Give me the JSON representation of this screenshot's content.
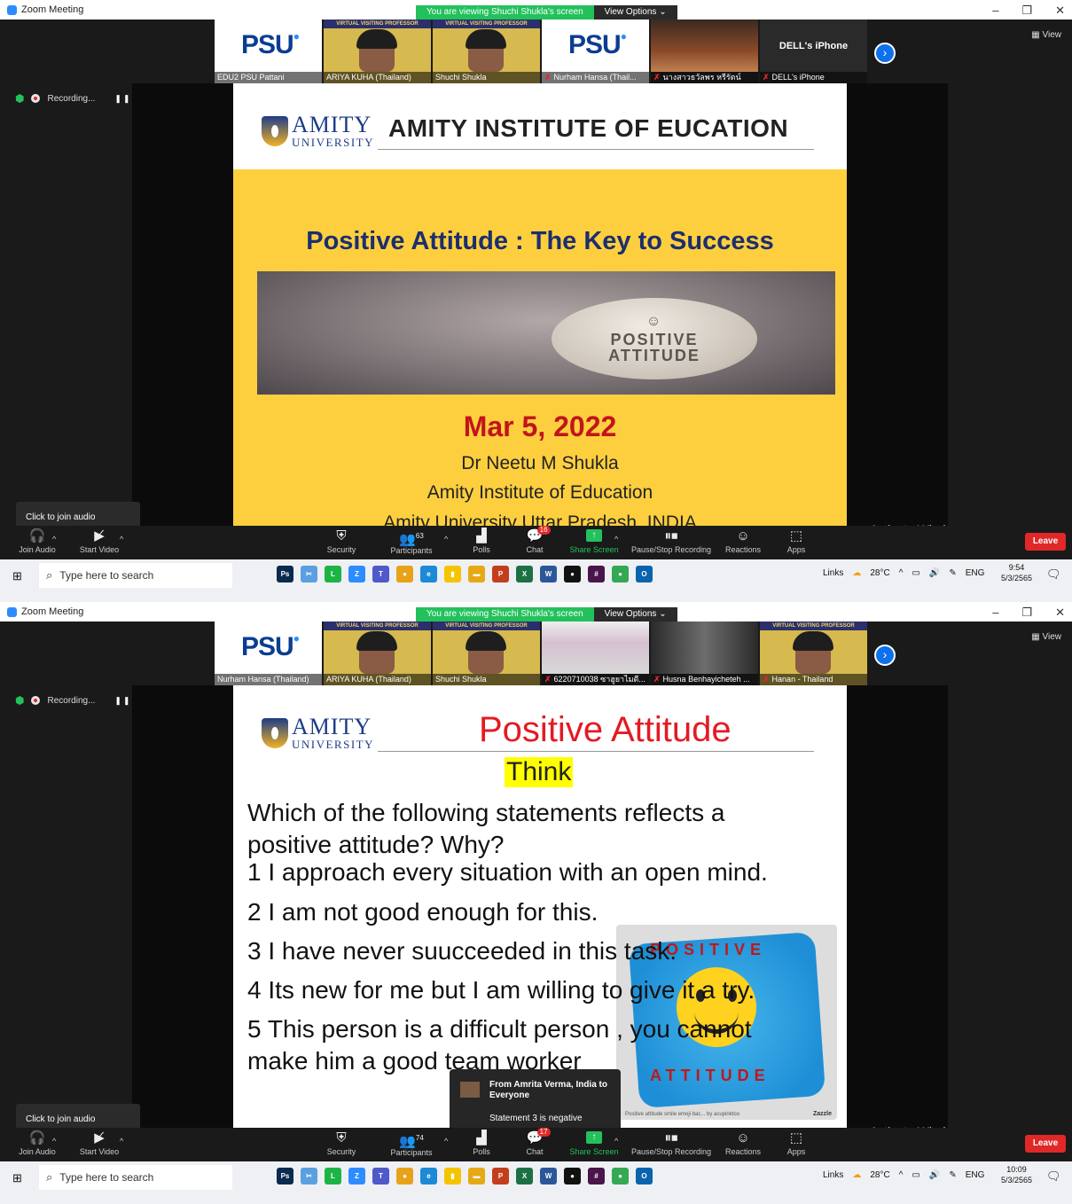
{
  "colors": {
    "zoom_blue": "#2d8cff",
    "leave_red": "#e02828",
    "share_green": "#23c15c",
    "slide_yellow": "#fdcf3f",
    "amity_navy": "#1c2e6e"
  },
  "shots": [
    {
      "window_title": "Zoom Meeting",
      "banner_text": "You are viewing Shuchi Shukla's screen",
      "view_options": "View Options",
      "view_label": "View",
      "recording": "Recording...",
      "participants": [
        {
          "name": "EDU2 PSU Pattani",
          "kind": "psu",
          "muted": false
        },
        {
          "name": "ARIYA KUHA (Thailand)",
          "kind": "vvp",
          "muted": false
        },
        {
          "name": "Shuchi Shukla",
          "kind": "vvp",
          "muted": false
        },
        {
          "name": "Nurham Hansa (Thail...",
          "kind": "psu",
          "muted": true
        },
        {
          "name": "นางสาวธวัลพร หรีรัตน์",
          "kind": "photo",
          "muted": true
        },
        {
          "name": "DELL's iPhone",
          "kind": "text",
          "muted": true,
          "text": "DELL's iPhone"
        }
      ],
      "slide": {
        "logo_big": "AMITY",
        "logo_small": "UNIVERSITY",
        "header": "AMITY INSTITUTE OF EUCATION",
        "title": "Positive Attitude : The Key to Success",
        "stone_text_1": "POSITIVE",
        "stone_text_2": "ATTITUDE",
        "date": "Mar 5, 2022",
        "line1": "Dr Neetu M Shukla",
        "line2": "Amity Institute of Education",
        "line3": "Amity University Uttar Pradesh, INDIA"
      },
      "tooltip": "Click to join audio",
      "activate_1": "Activate Windows",
      "activate_2": "Go to Settings to activate Windows.",
      "toolbar": {
        "join_audio": "Join Audio",
        "start_video": "Start Video",
        "security": "Security",
        "participants": "Participants",
        "participant_count": "63",
        "polls": "Polls",
        "chat": "Chat",
        "chat_badge": "16",
        "share_screen": "Share Screen",
        "pause_stop": "Pause/Stop Recording",
        "reactions": "Reactions",
        "apps": "Apps",
        "leave": "Leave"
      },
      "taskbar": {
        "search_placeholder": "Type here to search",
        "links": "Links",
        "temp": "28°C",
        "lang": "ENG",
        "time": "9:54",
        "date": "5/3/2565"
      }
    },
    {
      "window_title": "Zoom Meeting",
      "banner_text": "You are viewing Shuchi Shukla's screen",
      "view_options": "View Options",
      "view_label": "View",
      "recording": "Recording...",
      "participants": [
        {
          "name": "Nurham Hansa (Thailand)",
          "kind": "psu",
          "muted": false
        },
        {
          "name": "ARIYA KUHA (Thailand)",
          "kind": "vvp",
          "muted": false
        },
        {
          "name": "Shuchi Shukla",
          "kind": "vvp",
          "muted": false
        },
        {
          "name": "6220710038 ซาฮูยาไมดี...",
          "kind": "photo2",
          "muted": true
        },
        {
          "name": "Husna Benhayicheteh ...",
          "kind": "room",
          "muted": true
        },
        {
          "name": "Hanan - Thailand",
          "kind": "vvp",
          "muted": true
        }
      ],
      "slide": {
        "logo_big": "AMITY",
        "logo_small": "UNIVERSITY",
        "title": "Positive Attitude",
        "think": "Think",
        "question": "Which of the following statements reflects a positive attitude? Why?",
        "items": [
          "1 I approach every situation with an open mind.",
          "2 I am not good enough for this.",
          "3 I have never suucceeded in this task.",
          "4 Its new for me but I am willing to give it a try.",
          "5 This person is a difficult person , you cannot",
          "make him a good team worker"
        ],
        "pillow_top": "POSITIVE",
        "pillow_bottom": "ATTITUDE",
        "pillow_caption": "Positive attitude smile emoji bac... by acupinktoo",
        "pillow_brand": "Zazzle"
      },
      "chat_popup": {
        "from": "From Amrita Verma, India to Everyone",
        "message": "Statement 3 is negative"
      },
      "tooltip": "Click to join audio",
      "activate_1": "Activate Windows",
      "activate_2": "Go to Settings to activate Windows.",
      "toolbar": {
        "join_audio": "Join Audio",
        "start_video": "Start Video",
        "security": "Security",
        "participants": "Participants",
        "participant_count": "74",
        "polls": "Polls",
        "chat": "Chat",
        "chat_badge": "17",
        "share_screen": "Share Screen",
        "pause_stop": "Pause/Stop Recording",
        "reactions": "Reactions",
        "apps": "Apps",
        "leave": "Leave"
      },
      "taskbar": {
        "search_placeholder": "Type here to search",
        "links": "Links",
        "temp": "28°C",
        "lang": "ENG",
        "time": "10:09",
        "date": "5/3/2565"
      }
    }
  ],
  "taskbar_apps": [
    {
      "name": "photoshop-icon",
      "label": "Ps",
      "color": "#0b2a4f"
    },
    {
      "name": "snipping-icon",
      "label": "✂",
      "color": "#5aa0e0"
    },
    {
      "name": "line-icon",
      "label": "L",
      "color": "#1db446"
    },
    {
      "name": "zoom-app-icon",
      "label": "Z",
      "color": "#2d8cff"
    },
    {
      "name": "teams-icon",
      "label": "T",
      "color": "#5059c9"
    },
    {
      "name": "chrome-icon",
      "label": "●",
      "color": "#e8a21a"
    },
    {
      "name": "edge-icon",
      "label": "e",
      "color": "#1c8ad6"
    },
    {
      "name": "sticky-icon",
      "label": "▮",
      "color": "#f5c400"
    },
    {
      "name": "explorer-icon",
      "label": "▬",
      "color": "#e6a916"
    },
    {
      "name": "powerpoint-icon",
      "label": "P",
      "color": "#c43e1c"
    },
    {
      "name": "excel-icon",
      "label": "X",
      "color": "#1d7044"
    },
    {
      "name": "word-icon",
      "label": "W",
      "color": "#2b579a"
    },
    {
      "name": "record-icon",
      "label": "●",
      "color": "#111"
    },
    {
      "name": "slack-icon",
      "label": "#",
      "color": "#4a154b"
    },
    {
      "name": "chrome2-icon",
      "label": "●",
      "color": "#34a853"
    },
    {
      "name": "outlook-icon",
      "label": "O",
      "color": "#0a64ad"
    }
  ]
}
